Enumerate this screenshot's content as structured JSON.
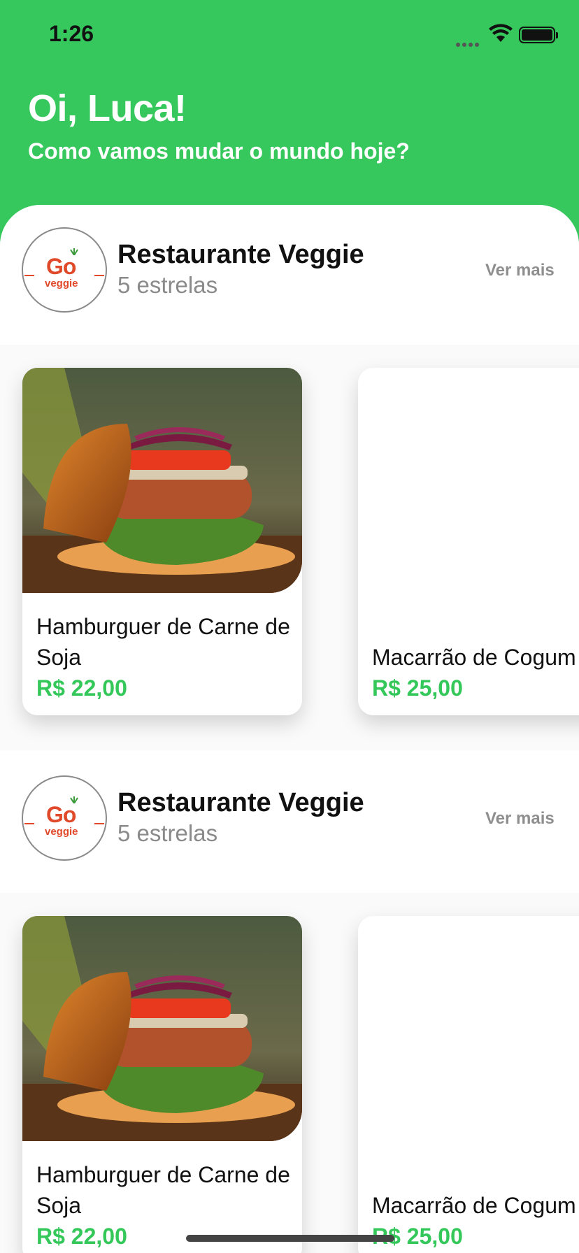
{
  "status_bar": {
    "time": "1:26"
  },
  "header": {
    "greeting": "Oi, Luca!",
    "subtitle": "Como vamos mudar o mundo hoje?"
  },
  "sections": [
    {
      "restaurant": {
        "name": "Restaurante Veggie",
        "rating": "5 estrelas",
        "logo_text_top": "Go",
        "logo_text_bottom": "veggie"
      },
      "see_more_label": "Ver mais",
      "items": [
        {
          "name": "Hamburguer de Carne de Soja",
          "price": "R$ 22,00",
          "image": "veggie-burger-photo"
        },
        {
          "name": "Macarrão de Cogum",
          "price": "R$ 25,00",
          "image": "blank"
        }
      ]
    },
    {
      "restaurant": {
        "name": "Restaurante Veggie",
        "rating": "5 estrelas",
        "logo_text_top": "Go",
        "logo_text_bottom": "veggie"
      },
      "see_more_label": "Ver mais",
      "items": [
        {
          "name": "Hamburguer de Carne de Soja",
          "price": "R$ 22,00",
          "image": "veggie-burger-photo"
        },
        {
          "name": "Macarrão de Cogum",
          "price": "R$ 25,00",
          "image": "blank"
        }
      ]
    }
  ],
  "colors": {
    "brand_green": "#36c85c",
    "price_green": "#34c759",
    "logo_orange": "#e04a2a"
  }
}
